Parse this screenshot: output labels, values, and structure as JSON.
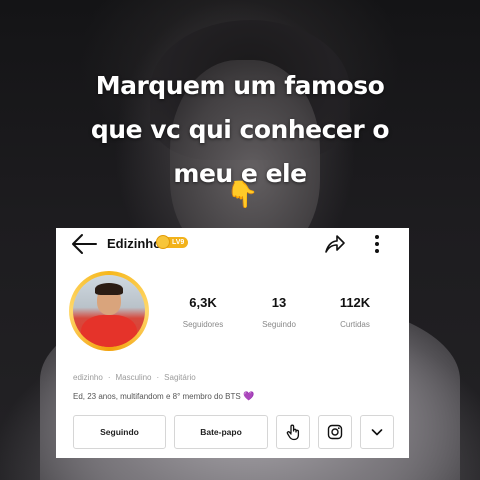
{
  "overlay": {
    "caption_lines": [
      "Marquem um famoso",
      "que vc qui conhecer o",
      "meu e ele"
    ],
    "pointer_emoji": "👇"
  },
  "profile": {
    "username": "Edizinho",
    "level_badge": "LV9",
    "stats": [
      {
        "value": "6,3K",
        "label": "Seguidores"
      },
      {
        "value": "13",
        "label": "Seguindo"
      },
      {
        "value": "112K",
        "label": "Curtidas"
      }
    ],
    "meta": {
      "handle": "edizinho",
      "gender": "Masculino",
      "sign": "Sagitário"
    },
    "bio": "Ed, 23 anos, multifandom e 8° membro do BTS",
    "bio_emoji": "💜",
    "buttons": {
      "following": "Seguindo",
      "chat": "Bate-papo"
    },
    "icons": {
      "back": "arrow-left-icon",
      "share": "share-icon",
      "more": "more-vertical-icon",
      "poke": "hand-tap-icon",
      "instagram": "instagram-icon",
      "expand": "chevron-down-icon"
    },
    "colors": {
      "level_badge": "#f2b21a",
      "heart": "#9b3dd6"
    }
  }
}
